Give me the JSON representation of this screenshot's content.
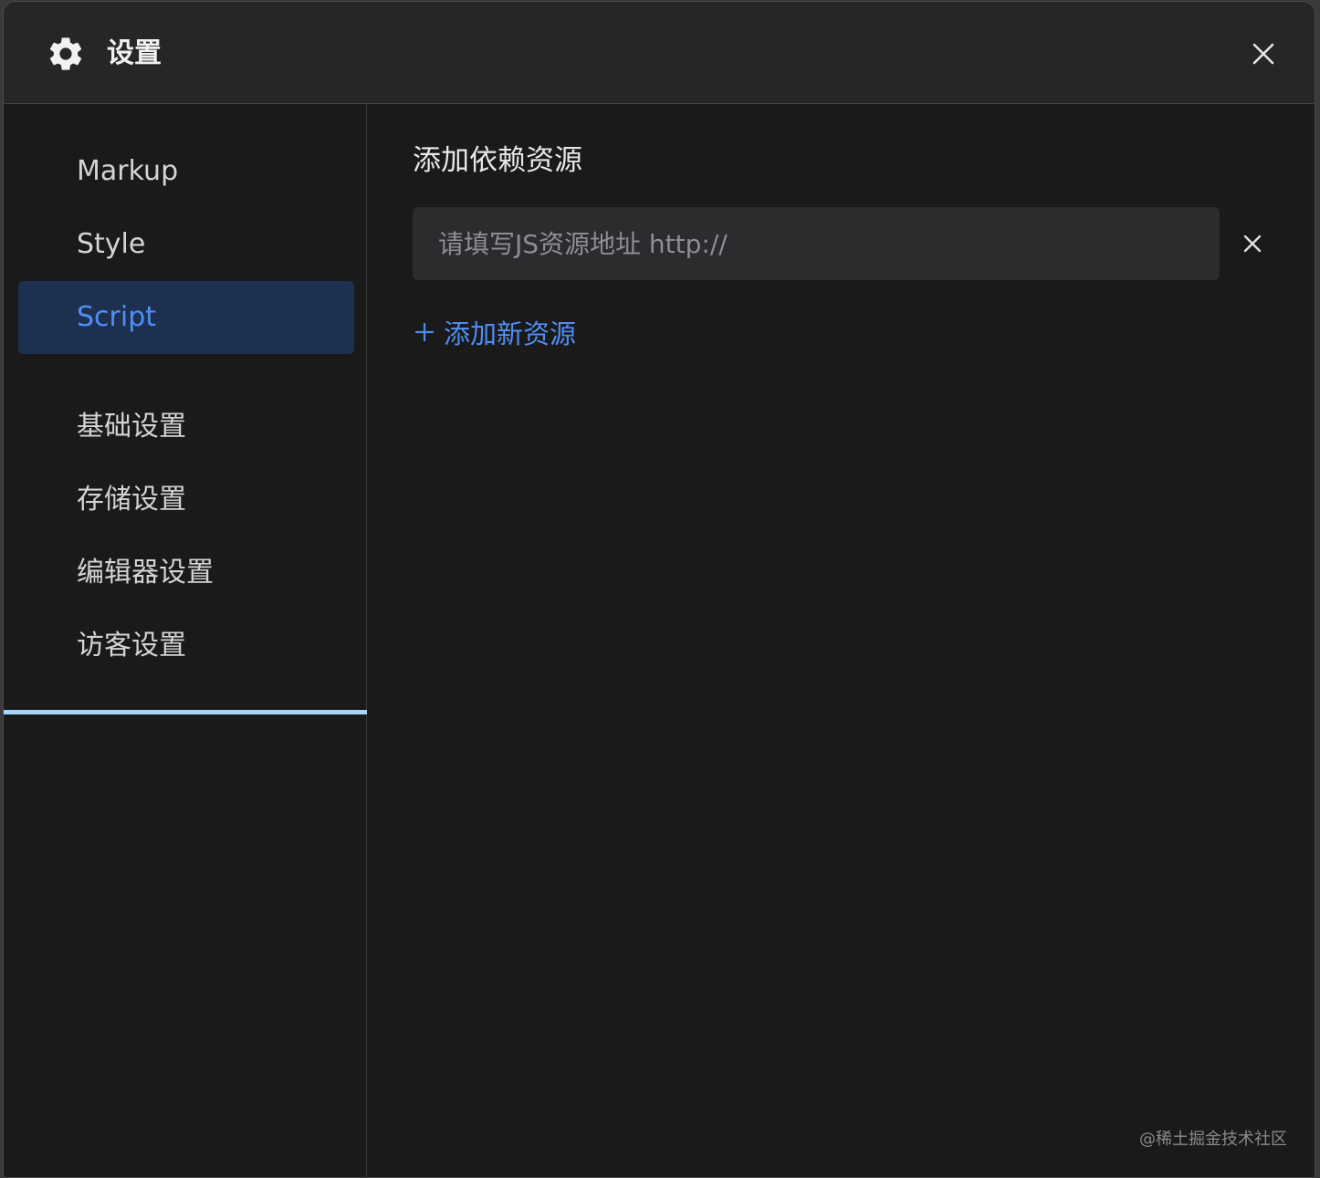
{
  "header": {
    "title": "设置",
    "icon": "gear-icon",
    "close_icon": "close-icon"
  },
  "sidebar": {
    "items": [
      {
        "label": "Markup",
        "active": false
      },
      {
        "label": "Style",
        "active": false
      },
      {
        "label": "Script",
        "active": true
      },
      {
        "label": "基础设置",
        "active": false
      },
      {
        "label": "存储设置",
        "active": false
      },
      {
        "label": "编辑器设置",
        "active": false
      },
      {
        "label": "访客设置",
        "active": false
      }
    ]
  },
  "main": {
    "section_title": "添加依赖资源",
    "resource_input": {
      "value": "",
      "placeholder": "请填写JS资源地址 http://"
    },
    "remove_icon": "close-icon",
    "add_label": "添加新资源",
    "add_icon": "plus-icon"
  },
  "watermark": "@稀土掘金技术社区",
  "colors": {
    "accent": "#4f8ef5",
    "active_bg": "#1e3050",
    "background": "#1a1a1b",
    "header_bg": "#262628",
    "input_bg": "#2c2c2e",
    "divider_highlight": "#a8d3f8"
  }
}
